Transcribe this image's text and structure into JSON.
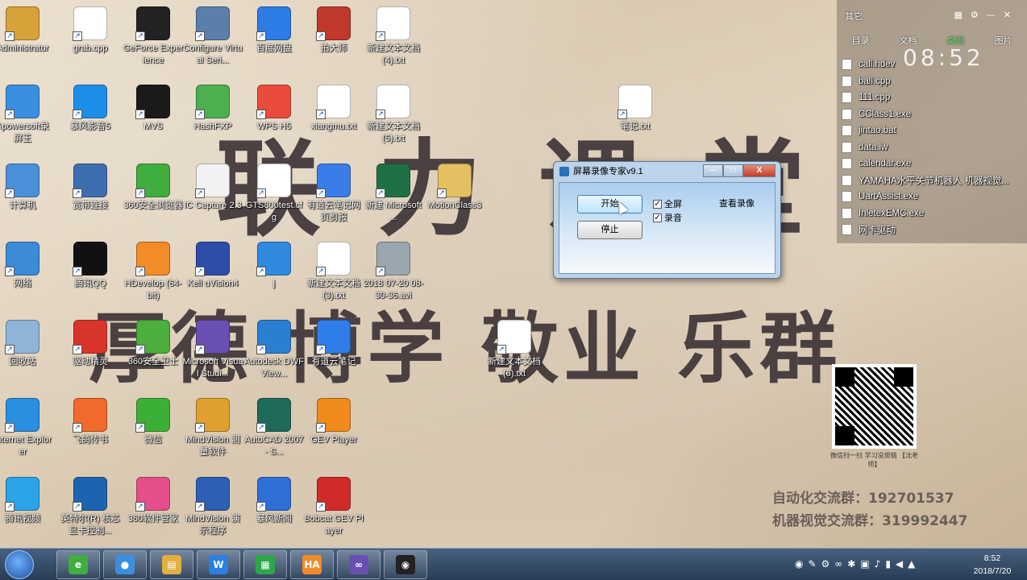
{
  "wallpaper": {
    "slogan_top": "联力课堂",
    "slogan_bottom": "厚德 博学 敬业 乐群",
    "contact_automation": "自动化交流群：192701537",
    "contact_vision": "机器视觉交流群：319992447",
    "qr_caption": "微信扫一扫 学习没烦恼 【沈老师】"
  },
  "desktop_icons": [
    {
      "label": "Administrator",
      "color": "#d8a23a"
    },
    {
      "label": "grab.cpp",
      "color": "#ffffff"
    },
    {
      "label": "GeForce Experience",
      "color": "#222222"
    },
    {
      "label": "Configure Virtual Seri...",
      "color": "#5a7fa8"
    },
    {
      "label": "百度网盘",
      "color": "#2d7be5"
    },
    {
      "label": "拍大师",
      "color": "#c0392b"
    },
    {
      "label": "新建文本文档 (4).txt",
      "color": "#ffffff"
    },
    {
      "label": "Apowersoft录屏王",
      "color": "#3b8fe0"
    },
    {
      "label": "暴风影音5",
      "color": "#1d8ee8"
    },
    {
      "label": "MVS",
      "color": "#1a1a1a"
    },
    {
      "label": "HashFXP",
      "color": "#4caf50"
    },
    {
      "label": "WPS H5",
      "color": "#e94b3c"
    },
    {
      "label": "xiangmu.txt",
      "color": "#ffffff"
    },
    {
      "label": "新建文本文档 (5).txt",
      "color": "#ffffff"
    },
    {
      "label": "笔记.txt",
      "color": "#ffffff"
    },
    {
      "label": "计算机",
      "color": "#4a90d9"
    },
    {
      "label": "宽带连接",
      "color": "#3d6fb0"
    },
    {
      "label": "360安全浏览器",
      "color": "#3fae3f"
    },
    {
      "label": "IC Capture 2.3",
      "color": "#f2f2f2"
    },
    {
      "label": "GTS800test.cfg",
      "color": "#ffffff"
    },
    {
      "label": "有道云笔记网页剪报",
      "color": "#3a7de8"
    },
    {
      "label": "新建 Microsoft ...",
      "color": "#1e7145"
    },
    {
      "label": "MotionClass3",
      "color": "#e5c061"
    },
    {
      "label": "网络",
      "color": "#3c8ad8"
    },
    {
      "label": "腾讯QQ",
      "color": "#111111"
    },
    {
      "label": "HDevelop (64-bit)",
      "color": "#f28c28"
    },
    {
      "label": "Keil uVision4",
      "color": "#2c4ea8"
    },
    {
      "label": "j",
      "color": "#2f8ae0"
    },
    {
      "label": "新建文本文档 (3).txt",
      "color": "#ffffff"
    },
    {
      "label": "2018 07-20 08-30-36.avi",
      "color": "#9aa7b0"
    },
    {
      "label": "回收站",
      "color": "#8fb4d8"
    },
    {
      "label": "驱动精灵",
      "color": "#d9342b"
    },
    {
      "label": "360安全卫士",
      "color": "#4cae3c"
    },
    {
      "label": "Microsoft Visual Studi...",
      "color": "#6a4fb3"
    },
    {
      "label": "Autodesk DWF View...",
      "color": "#2a7fd1"
    },
    {
      "label": "有道云笔记",
      "color": "#2e7de8"
    },
    {
      "label": "新建文本文档 (6).txt",
      "color": "#ffffff"
    },
    {
      "label": "Internet Explorer",
      "color": "#2a8fe0"
    },
    {
      "label": "飞鸽传书",
      "color": "#f06a2b"
    },
    {
      "label": "微信",
      "color": "#3cb034"
    },
    {
      "label": "MindVision 测量软件",
      "color": "#e0a030"
    },
    {
      "label": "AutoCAD 2007 - S...",
      "color": "#1f6b5a"
    },
    {
      "label": "GEV Player",
      "color": "#f08a1a"
    },
    {
      "label": "腾讯视频",
      "color": "#2aa3e8"
    },
    {
      "label": "英特尔(R) 核芯显卡控制...",
      "color": "#1d64b0"
    },
    {
      "label": "360软件管家",
      "color": "#e54e8a"
    },
    {
      "label": "MindVision 演示程序",
      "color": "#2d5fb5"
    },
    {
      "label": "暴风新闻",
      "color": "#2f6fd6"
    },
    {
      "label": "Bobcat GEV Player",
      "color": "#d12a2a"
    }
  ],
  "side_panel": {
    "top_label": "其它",
    "tabs": [
      "目录",
      "文档",
      "桌面",
      "图片"
    ],
    "active_tab": "桌面",
    "clock": "08:52",
    "files": [
      "call.hdev",
      "ball.cpp",
      "111.cpp",
      "CClass1.exe",
      "jintao.bat",
      "data.lw",
      "calendar.exe",
      "YAMAHA水平关节机器人 机器视觉...",
      "UartAssist.exe",
      "InletexEMC.exe",
      "网卡驱动"
    ]
  },
  "recorder": {
    "title": "屏幕录像专家v9.1",
    "start_label": "开始",
    "stop_label": "停止",
    "fullscreen_label": "全屏",
    "audio_label": "录音",
    "view_label": "查看录像",
    "minimize": "—",
    "maximize": "□",
    "close": "X"
  },
  "taskbar": {
    "time": "8:52",
    "date": "2018/7/20",
    "apps": [
      {
        "name": "360-browser",
        "color": "#3fae3f",
        "glyph": "e"
      },
      {
        "name": "apowersoft",
        "color": "#3b8fe0",
        "glyph": "●"
      },
      {
        "name": "explorer",
        "color": "#e0b040",
        "glyph": "▤"
      },
      {
        "name": "wps",
        "color": "#2a7fe0",
        "glyph": "W"
      },
      {
        "name": "inletex",
        "color": "#2fa64a",
        "glyph": "▦"
      },
      {
        "name": "hdevelop",
        "color": "#f28c28",
        "glyph": "HA"
      },
      {
        "name": "visual-studio",
        "color": "#6a4fb3",
        "glyph": "∞"
      },
      {
        "name": "mvs",
        "color": "#222222",
        "glyph": "◉"
      }
    ]
  }
}
